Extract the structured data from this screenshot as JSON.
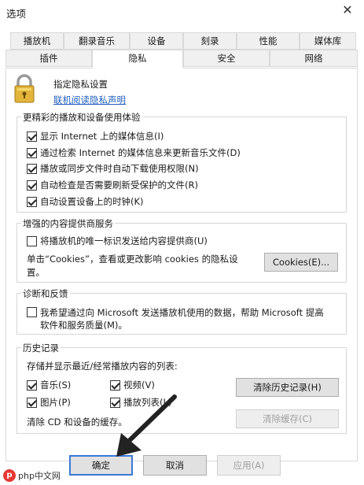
{
  "window": {
    "title": "选项",
    "close_glyph": "✕"
  },
  "tabs_row1": [
    {
      "label": "播放机"
    },
    {
      "label": "翻录音乐"
    },
    {
      "label": "设备"
    },
    {
      "label": "刻录"
    },
    {
      "label": "性能"
    },
    {
      "label": "媒体库"
    }
  ],
  "tabs_row2": [
    {
      "label": "插件"
    },
    {
      "label": "隐私",
      "active": true
    },
    {
      "label": "安全"
    },
    {
      "label": "网络"
    }
  ],
  "header": {
    "title": "指定隐私设置",
    "link": "联机阅读隐私声明"
  },
  "group_experience": {
    "legend": "更精彩的播放和设备使用体验",
    "items": [
      {
        "label": "显示 Internet 上的媒体信息(I)",
        "checked": true
      },
      {
        "label": "通过检索 Internet 的媒体信息来更新音乐文件(D)",
        "checked": true
      },
      {
        "label": "播放或同步文件时自动下载使用权限(N)",
        "checked": true
      },
      {
        "label": "自动检查是否需要刷新受保护的文件(R)",
        "checked": true
      },
      {
        "label": "自动设置设备上的时钟(K)",
        "checked": true
      }
    ]
  },
  "group_content": {
    "legend": "增强的内容提供商服务",
    "checkbox": {
      "label": "将播放机的唯一标识发送给内容提供商(U)",
      "checked": false
    },
    "note_line1": "单击“Cookies”，查看或更改影响 cookies 的隐私设",
    "note_line2": "置。",
    "cookies_button": "Cookies(E)..."
  },
  "group_feedback": {
    "legend": "诊断和反馈",
    "checkbox_line1": "我希望通过向 Microsoft 发送播放机使用的数据，帮助 Microsoft 提高",
    "checkbox_line2": "软件和服务质量(M)。",
    "checked": false
  },
  "group_history": {
    "legend": "历史记录",
    "desc": "存储并显示最近/经常播放内容的列表:",
    "items": [
      {
        "label": "音乐(S)",
        "checked": true
      },
      {
        "label": "视频(V)",
        "checked": true
      },
      {
        "label": "图片(P)",
        "checked": true
      },
      {
        "label": "播放列表(L)",
        "checked": true
      }
    ],
    "clear_history_button": "清除历史记录(H)",
    "clear_cache_text": "清除 CD 和设备的缓存。",
    "clear_cache_button": "清除缓存(C)"
  },
  "footer": {
    "ok": "确定",
    "cancel": "取消",
    "apply": "应用(A)"
  },
  "watermark": {
    "brand": "php中文网"
  }
}
